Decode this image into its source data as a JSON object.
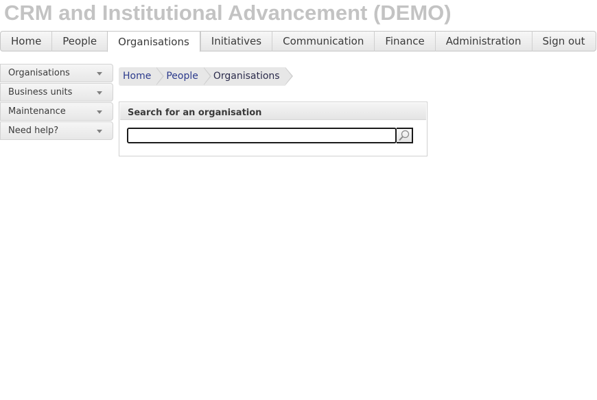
{
  "app": {
    "title": "CRM and Institutional Advancement (DEMO)"
  },
  "topnav": {
    "tabs": [
      {
        "label": "Home"
      },
      {
        "label": "People"
      },
      {
        "label": "Organisations",
        "active": true
      },
      {
        "label": "Initiatives"
      },
      {
        "label": "Communication"
      },
      {
        "label": "Finance"
      },
      {
        "label": "Administration"
      },
      {
        "label": "Sign out"
      }
    ]
  },
  "sidebar": {
    "items": [
      {
        "label": "Organisations"
      },
      {
        "label": "Business units"
      },
      {
        "label": "Maintenance"
      },
      {
        "label": "Need help?"
      }
    ]
  },
  "breadcrumb": [
    "Home",
    "People",
    "Organisations"
  ],
  "search_panel": {
    "title": "Search for an organisation",
    "input_value": "",
    "button_icon": "magnifier-icon"
  },
  "colors": {
    "title_gray": "#c3c3c3",
    "link_blue": "#2b3a8c"
  }
}
